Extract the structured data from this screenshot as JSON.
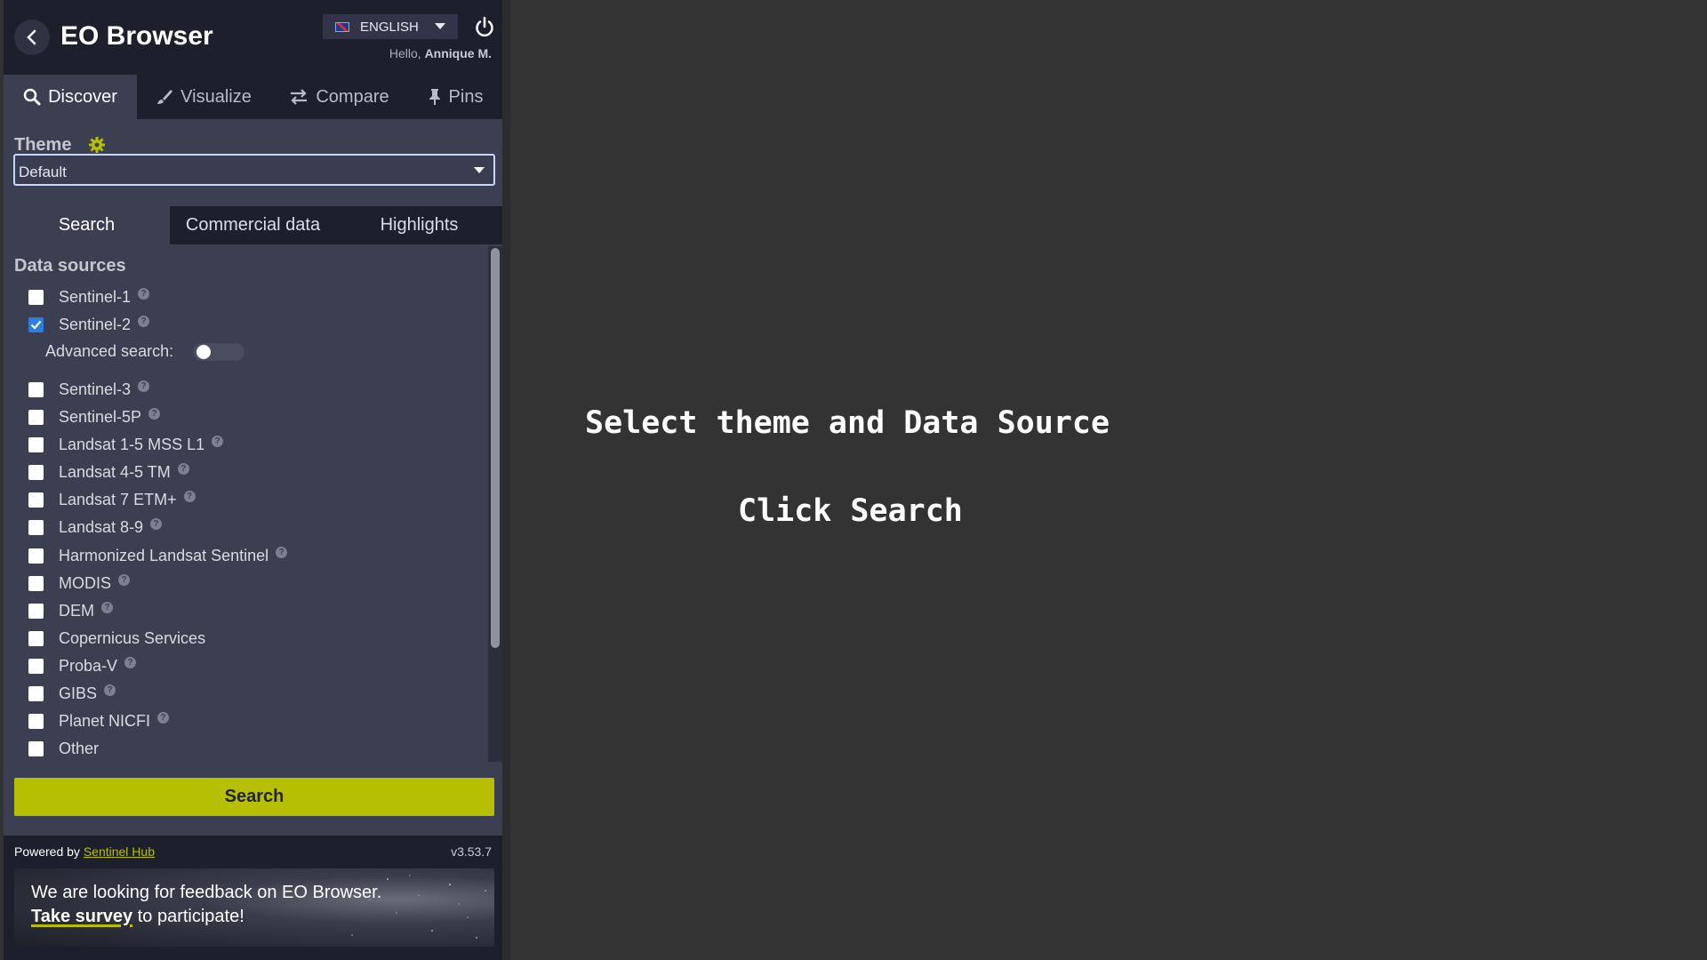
{
  "header": {
    "title": "EO Browser",
    "language": "ENGLISH",
    "greeting_prefix": "Hello,",
    "user_name": "Annique M."
  },
  "main_tabs": [
    {
      "label": "Discover",
      "icon": "search-icon"
    },
    {
      "label": "Visualize",
      "icon": "brush-icon"
    },
    {
      "label": "Compare",
      "icon": "compare-arrows-icon"
    },
    {
      "label": "Pins",
      "icon": "pin-icon"
    }
  ],
  "theme": {
    "label": "Theme",
    "selected": "Default"
  },
  "sub_tabs": [
    "Search",
    "Commercial data",
    "Highlights"
  ],
  "data_sources": {
    "title": "Data sources",
    "advanced_search_label": "Advanced search:",
    "items": [
      {
        "label": "Sentinel-1",
        "checked": false,
        "help": true
      },
      {
        "label": "Sentinel-2",
        "checked": true,
        "help": true
      },
      {
        "label": "Sentinel-3",
        "checked": false,
        "help": true
      },
      {
        "label": "Sentinel-5P",
        "checked": false,
        "help": true
      },
      {
        "label": "Landsat 1-5 MSS L1",
        "checked": false,
        "help": true
      },
      {
        "label": "Landsat 4-5 TM",
        "checked": false,
        "help": true
      },
      {
        "label": "Landsat 7 ETM+",
        "checked": false,
        "help": true
      },
      {
        "label": "Landsat 8-9",
        "checked": false,
        "help": true
      },
      {
        "label": "Harmonized Landsat Sentinel",
        "checked": false,
        "help": true
      },
      {
        "label": "MODIS",
        "checked": false,
        "help": true
      },
      {
        "label": "DEM",
        "checked": false,
        "help": true
      },
      {
        "label": "Copernicus Services",
        "checked": false,
        "help": false
      },
      {
        "label": "Proba-V",
        "checked": false,
        "help": true
      },
      {
        "label": "GIBS",
        "checked": false,
        "help": true
      },
      {
        "label": "Planet NICFI",
        "checked": false,
        "help": true
      },
      {
        "label": "Other",
        "checked": false,
        "help": false
      }
    ]
  },
  "search_button": "Search",
  "footer": {
    "powered_by": "Powered by",
    "powered_link": "Sentinel Hub",
    "version": "v3.53.7",
    "banner_line1": "We are looking for feedback on EO Browser.",
    "banner_link": "Take survey",
    "banner_line2_rest": "to participate!"
  },
  "overlay": {
    "line1": "Select theme and Data Source",
    "line2": "Click Search"
  },
  "colors": {
    "accent": "#b6bf00",
    "panel": "#3c3e52",
    "header": "#1d1f2c",
    "background": "#333333"
  }
}
